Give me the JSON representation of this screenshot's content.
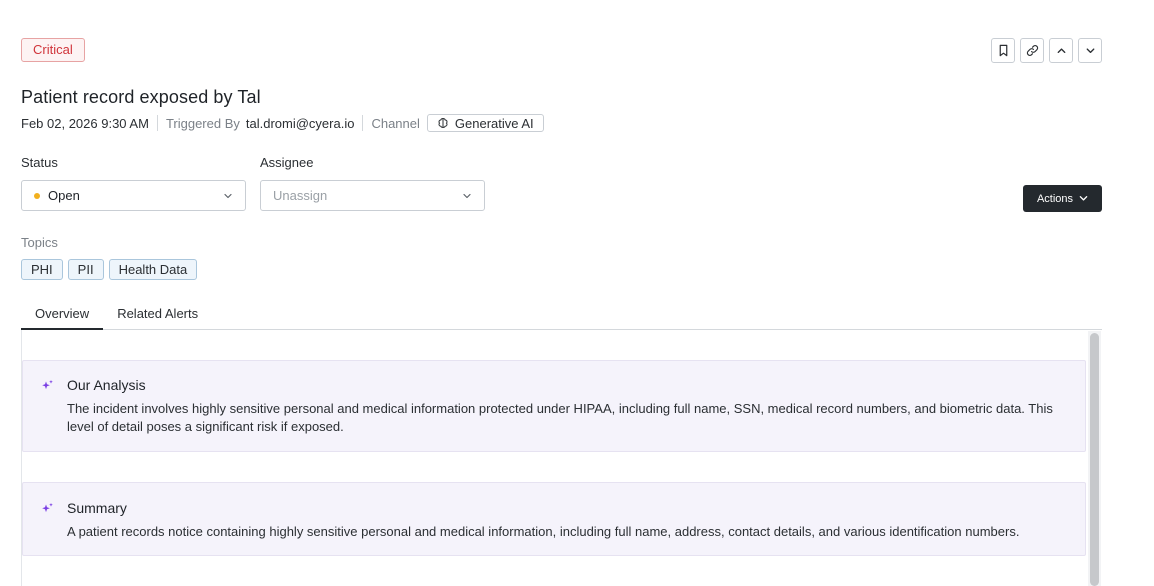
{
  "header": {
    "severity": "Critical",
    "title": "Patient record exposed by Tal",
    "date": "Feb 02, 2026 9:30 AM",
    "triggered_by_label": "Triggered By",
    "triggered_by_value": "tal.dromi@cyera.io",
    "channel_label": "Channel",
    "channel_value": "Generative AI"
  },
  "toolbar": {
    "icons": [
      "bookmark-icon",
      "link-icon",
      "chevron-up-icon",
      "chevron-down-icon"
    ]
  },
  "status": {
    "label": "Status",
    "value": "Open",
    "dot_color": "#f2b01e"
  },
  "assignee": {
    "label": "Assignee",
    "placeholder": "Unassign"
  },
  "actions": {
    "label": "Actions"
  },
  "topics": {
    "label": "Topics",
    "items": [
      "PHI",
      "PII",
      "Health Data"
    ]
  },
  "tabs": [
    {
      "label": "Overview",
      "active": true
    },
    {
      "label": "Related Alerts",
      "active": false
    }
  ],
  "cards": {
    "analysis": {
      "title": "Our Analysis",
      "body": "The incident involves highly sensitive personal and medical information protected under HIPAA, including full name, SSN, medical record numbers, and biometric data. This level of detail poses a significant risk if exposed."
    },
    "summary": {
      "title": "Summary",
      "body": "A patient records notice containing highly sensitive personal and medical information, including full name, address, contact details, and various identification numbers."
    }
  },
  "colors": {
    "critical": "#d0343a",
    "accent_purple": "#7b3fe4",
    "dark_button": "#24292e"
  }
}
